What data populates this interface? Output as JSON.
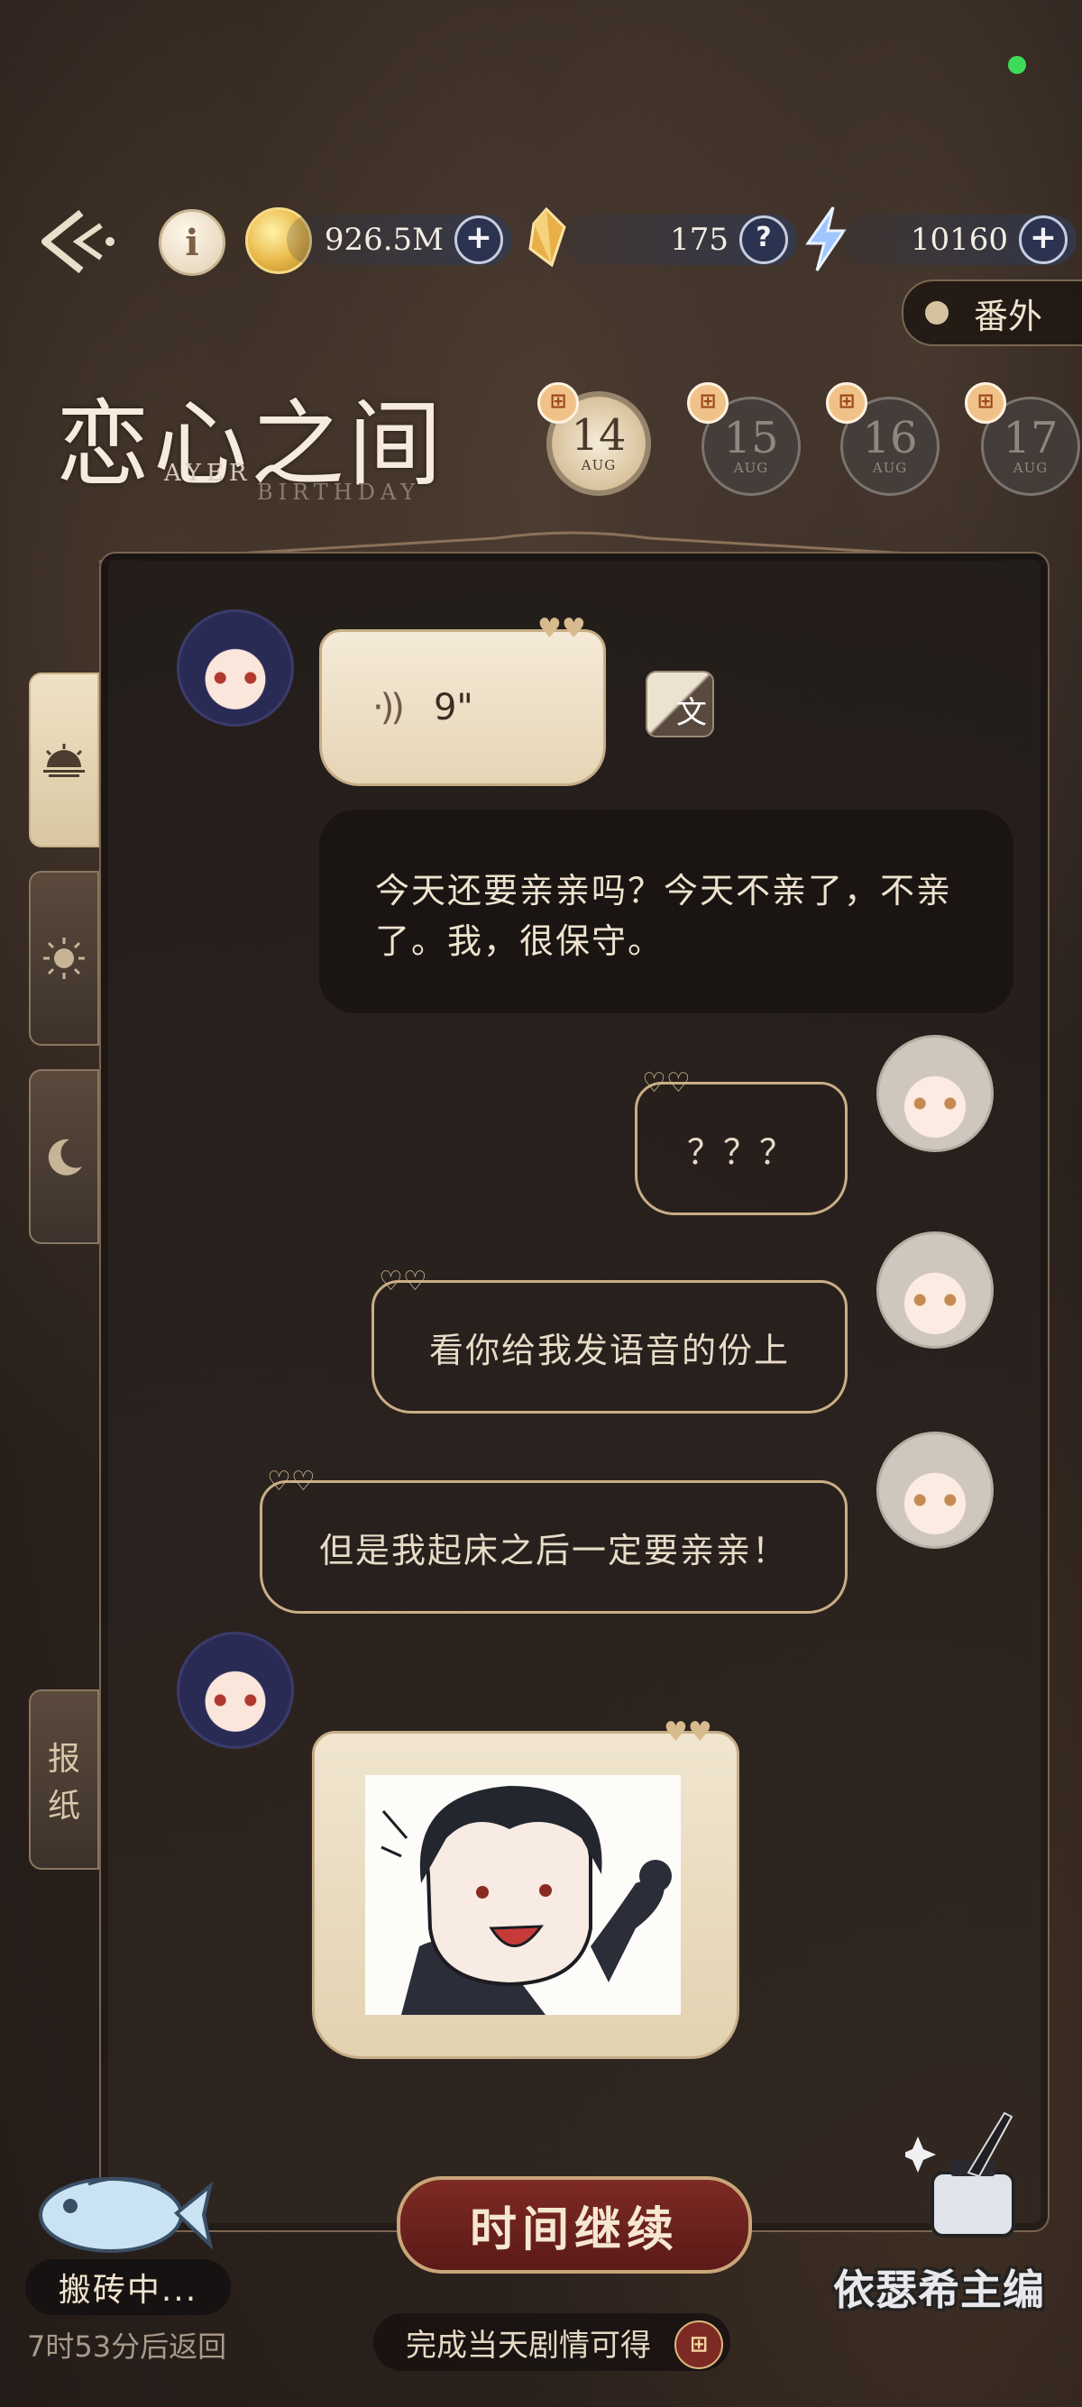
{
  "topbar": {
    "coins": "926.5M",
    "crystals": "175",
    "energy": "10160",
    "icons": [
      "back-arrow-icon",
      "info-icon",
      "coin-icon",
      "plus-icon",
      "crystal-icon",
      "question-icon",
      "energy-bolt-icon",
      "plus-icon"
    ]
  },
  "bangai_label": "番外",
  "title": {
    "main": "恋心之间",
    "en_left": "AYER",
    "en_right": "BIRTHDAY"
  },
  "dates": [
    {
      "day": "14",
      "month": "AUG",
      "active": true
    },
    {
      "day": "15",
      "month": "AUG",
      "active": false
    },
    {
      "day": "16",
      "month": "AUG",
      "active": false
    },
    {
      "day": "17",
      "month": "AUG",
      "active": false
    }
  ],
  "side_tabs": [
    "sunrise-icon",
    "sun-icon",
    "moon-icon"
  ],
  "newspaper_tab": {
    "line1": "报",
    "line2": "纸"
  },
  "messages": {
    "voice_duration": "9\"",
    "translate_icon_char": "文",
    "transcript": "今天还要亲亲吗？今天不亲了，不亲了。我，很保守。",
    "reply1": "？？？",
    "reply2": "看你给我发语音的份上",
    "reply3": "但是我起床之后一定要亲亲！"
  },
  "continue_label": "时间继续",
  "reward_label": "完成当天剧情可得",
  "work": {
    "status": "搬砖中...",
    "return_time": "7时53分后返回"
  },
  "editor_label": "依瑟希主编",
  "colors": {
    "accent_gold": "#c9ae86",
    "button_red": "#7e2a24",
    "status_green": "#3ddc58"
  }
}
